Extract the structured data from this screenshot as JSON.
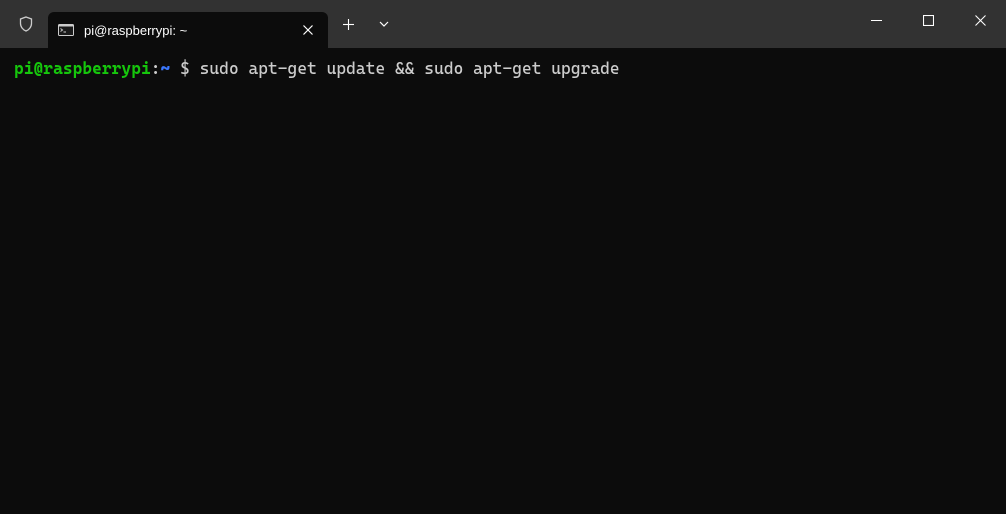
{
  "tab": {
    "title": "pi@raspberrypi: ~"
  },
  "prompt": {
    "user_host": "pi@raspberrypi",
    "colon": ":",
    "path": "~",
    "symbol": " $ "
  },
  "command": "sudo apt-get update && sudo apt-get upgrade"
}
